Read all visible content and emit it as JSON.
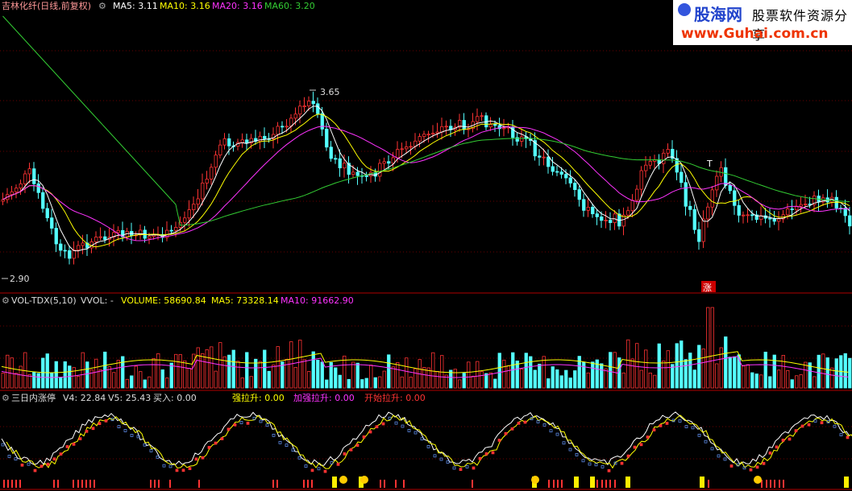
{
  "header": {
    "stock_name": "吉林化纤(日线,前复权)",
    "ma5": "MA5: 3.11",
    "ma10": "MA10: 3.16",
    "ma20": "MA20: 3.16",
    "ma60": "MA60: 3.20"
  },
  "price_panel": {
    "high_label": "3.65",
    "low_label": "2.90",
    "mark_t": "T",
    "zhang_badge": "涨"
  },
  "volume_panel": {
    "name": "VOL-TDX(5,10)",
    "vvol": "VVOL: -",
    "volume": "VOLUME: 58690.84",
    "ma5": "MA5: 73328.14",
    "ma10": "MA10: 91662.90"
  },
  "indicator_panel": {
    "name": "三日内涨停",
    "v4": "V4: 22.84",
    "v5": "V5: 25.43",
    "buy": "买入: 0.00",
    "strong": "强拉升: 0.00",
    "stronger": "加强拉升: 0.00",
    "start": "开始拉升: 0.00"
  },
  "watermark": {
    "logo": "股海网",
    "tagline": "股票软件资源分享",
    "url": "www.Guhai.com.cn"
  },
  "colors": {
    "up": "#ff3333",
    "down": "#54ffff",
    "ma5": "#ffffff",
    "ma10": "#ffff00",
    "ma20": "#ff33ff",
    "ma60": "#33cc33",
    "grid": "#8b0000"
  }
}
